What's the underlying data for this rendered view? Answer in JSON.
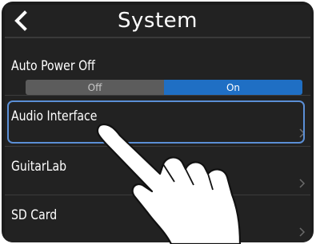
{
  "header": {
    "title": "System",
    "back_icon": "chevron-left-icon"
  },
  "settings": {
    "auto_power_off": {
      "label": "Auto Power Off",
      "options": [
        "Off",
        "On"
      ],
      "selected": "On"
    },
    "items": [
      {
        "label": "Audio Interface",
        "highlighted": true
      },
      {
        "label": "GuitarLab"
      },
      {
        "label": "SD Card"
      }
    ]
  },
  "colors": {
    "screen_bg": "#222222",
    "accent": "#1f6fc4",
    "highlight_border": "#5b8fd6"
  },
  "overlay": {
    "icon": "pointing-hand-icon"
  }
}
